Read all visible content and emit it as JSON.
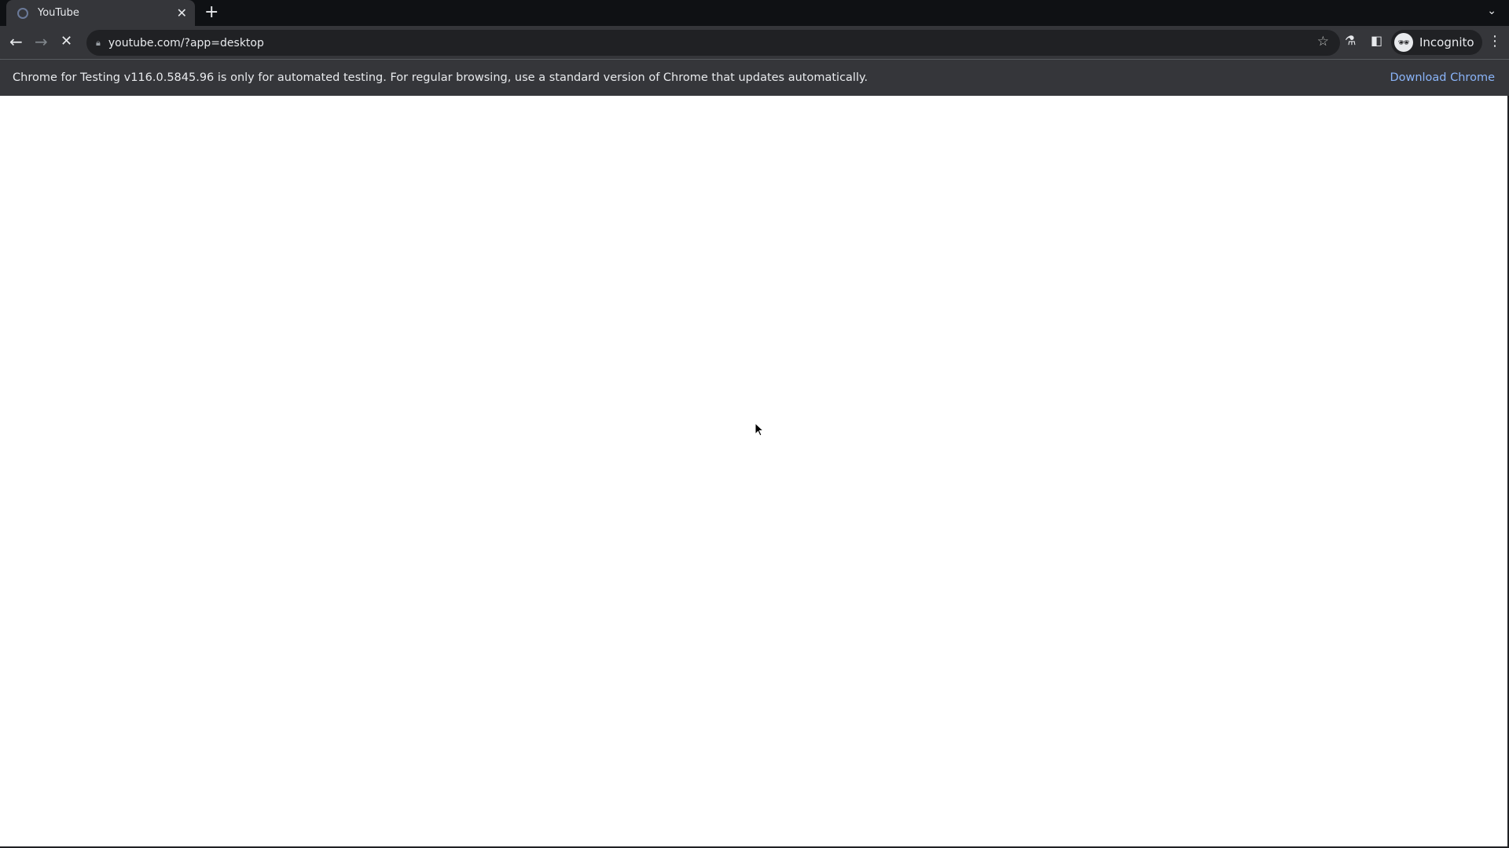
{
  "tab": {
    "title": "YouTube",
    "favicon": "loading-spinner-icon"
  },
  "toolbar": {
    "url": "youtube.com/?app=desktop",
    "profile_label": "Incognito"
  },
  "infobar": {
    "message": "Chrome for Testing v116.0.5845.96 is only for automated testing. For regular browsing, use a standard version of Chrome that updates automatically.",
    "link": "Download Chrome",
    "link_color": "#8ab4f8"
  }
}
